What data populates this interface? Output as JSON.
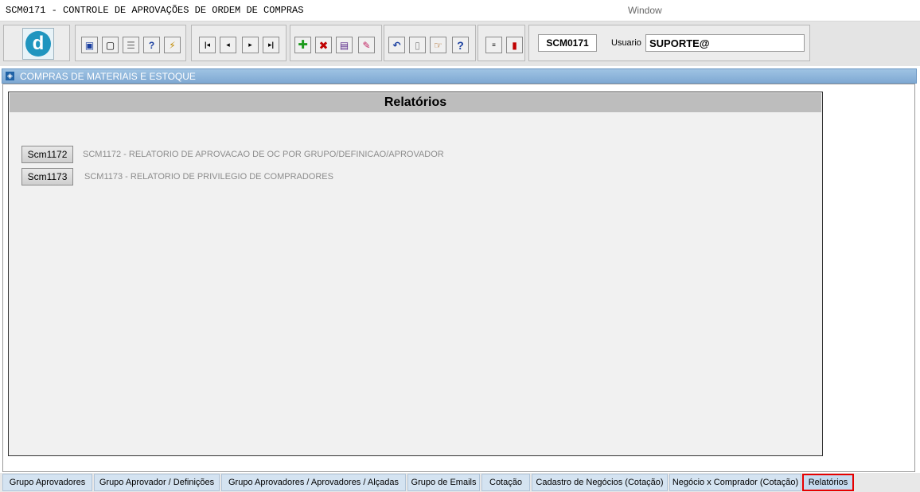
{
  "window": {
    "title": "SCM0171 - CONTROLE DE APROVAÇÕES DE ORDEM DE COMPRAS",
    "menu_window": "Window"
  },
  "toolbar": {
    "logo_letter": "d",
    "form_code": "SCM0171",
    "user_label": "Usuario",
    "user_value": "SUPORTE@"
  },
  "module": {
    "title": "COMPRAS DE MATERIAIS E ESTOQUE"
  },
  "panel": {
    "title": "Relatórios",
    "reports": [
      {
        "button": "Scm1172",
        "description": "SCM1172 - RELATORIO DE APROVACAO DE OC POR GRUPO/DEFINICAO/APROVADOR"
      },
      {
        "button": "Scm1173",
        "description": "SCM1173 - RELATORIO DE PRIVILEGIO DE COMPRADORES"
      }
    ]
  },
  "tabs": [
    {
      "label": "Grupo Aprovadores"
    },
    {
      "label": "Grupo Aprovador / Definições"
    },
    {
      "label": "Grupo Aprovadores / Aprovadores / Alçadas"
    },
    {
      "label": "Grupo de Emails"
    },
    {
      "label": "Cotação"
    },
    {
      "label": "Cadastro de Negócios (Cotação)"
    },
    {
      "label": "Negócio x Comprador (Cotação)"
    },
    {
      "label": "Relatórios"
    }
  ],
  "colors": {
    "accent": "#1f95bf",
    "header_blue": "#8fb6dc",
    "active_tab_outline": "#e60000"
  },
  "icons": [
    "save-icon",
    "window-icon",
    "print-icon",
    "query-help-icon",
    "query-run-icon",
    "first-record-icon",
    "previous-record-icon",
    "next-record-icon",
    "last-record-icon",
    "insert-record-icon",
    "delete-record-icon",
    "edit-record-icon",
    "clear-icon",
    "undo-icon",
    "paste-icon",
    "tools-icon",
    "help-icon",
    "menu-icon",
    "exit-icon"
  ]
}
